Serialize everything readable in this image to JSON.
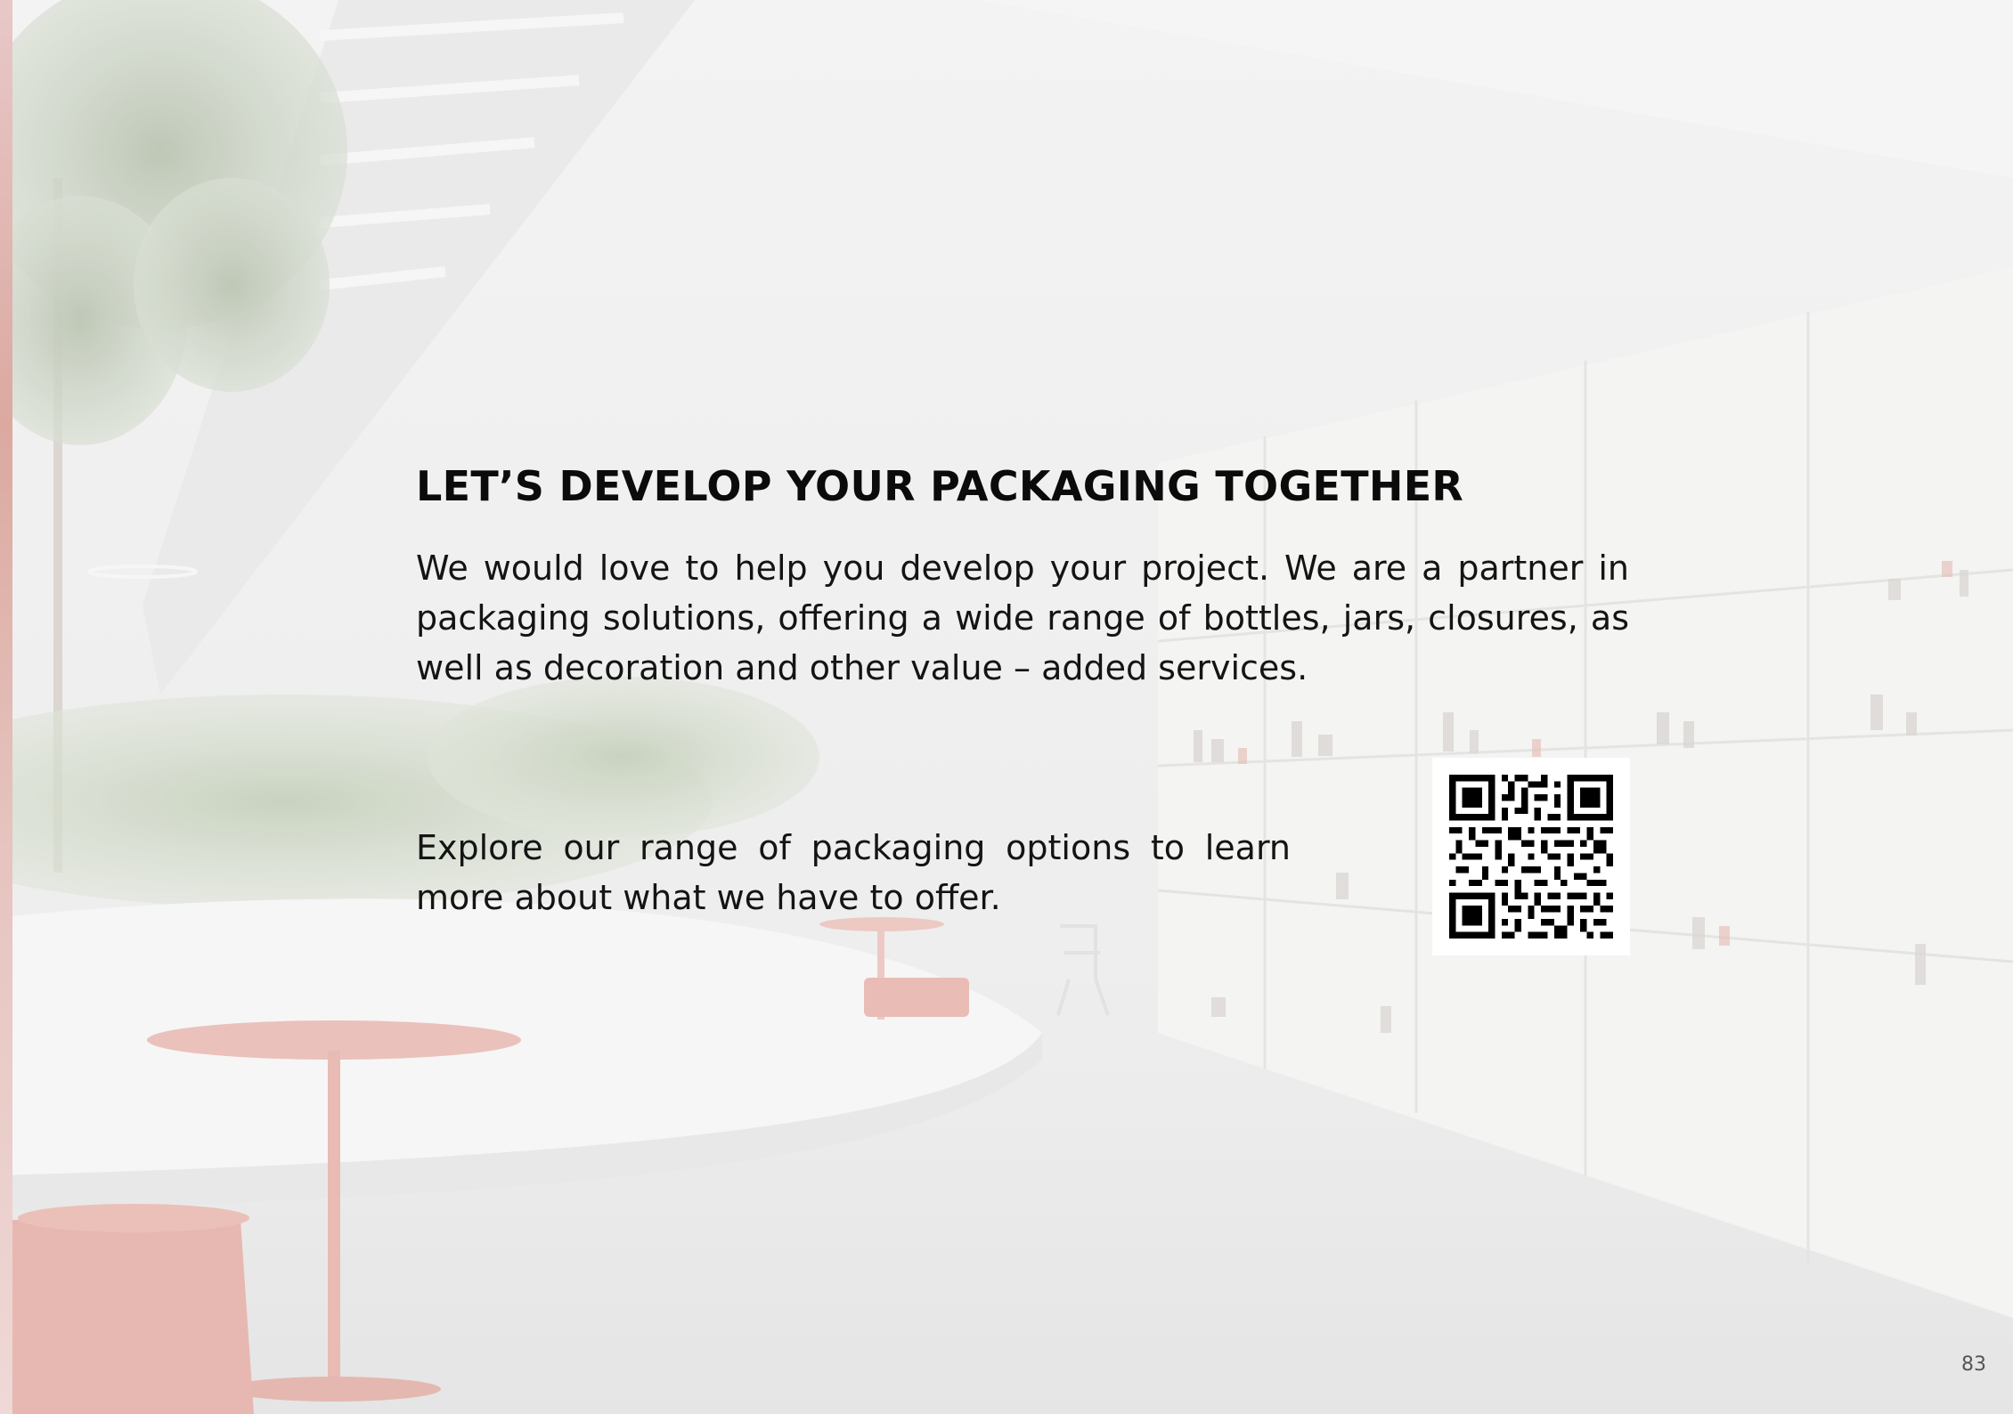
{
  "document": {
    "heading": "LET’S DEVELOP YOUR PACKAGING TOGETHER",
    "intro": "We would love to help you develop your project. We are a partner in packaging solutions, offering a wide range of bottles, jars, closures, as well as decoration and other value – added services.",
    "explore": "Explore our range of packaging options to learn more about what we have to offer.",
    "page_number": "83"
  },
  "background": {
    "description_icon": "showroom-photo",
    "accent_color": "#e06060",
    "text_color": "#0b0b0b"
  },
  "qr_code": {
    "icon": "qr-code-icon"
  }
}
